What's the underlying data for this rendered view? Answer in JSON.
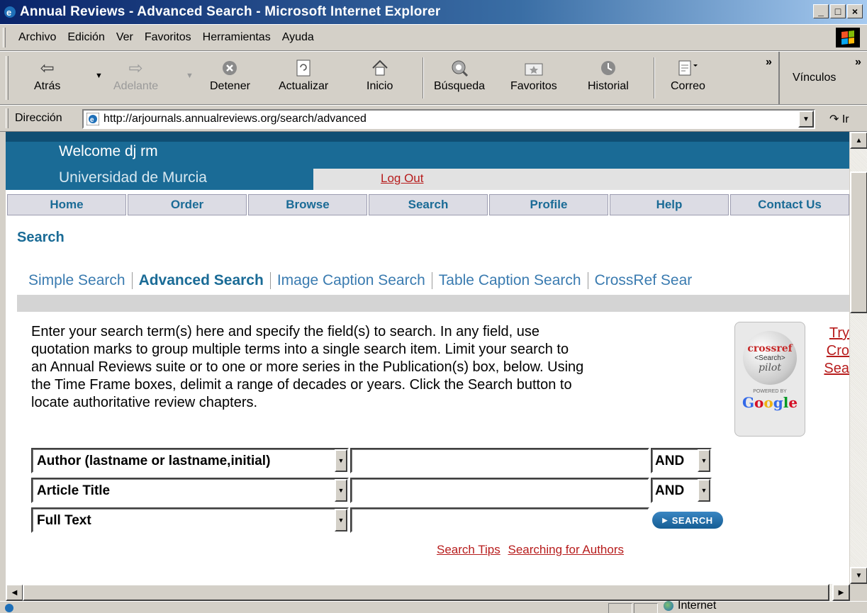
{
  "window": {
    "title": "Annual Reviews - Advanced Search - Microsoft Internet Explorer",
    "controls": [
      "_",
      "□",
      "×"
    ]
  },
  "menubar": {
    "items": [
      "Archivo",
      "Edición",
      "Ver",
      "Favoritos",
      "Herramientas",
      "Ayuda"
    ]
  },
  "toolbar": {
    "back": "Atrás",
    "forward": "Adelante",
    "stop": "Detener",
    "refresh": "Actualizar",
    "home": "Inicio",
    "search": "Búsqueda",
    "favorites": "Favoritos",
    "history": "Historial",
    "mail": "Correo",
    "links": "Vínculos"
  },
  "addressbar": {
    "label": "Dirección",
    "url": "http://arjournals.annualreviews.org/search/advanced",
    "go": "Ir"
  },
  "site": {
    "welcome": "Welcome dj rm",
    "institution": "Universidad de Murcia",
    "logout": "Log Out",
    "nav": [
      "Home",
      "Order",
      "Browse",
      "Search",
      "Profile",
      "Help",
      "Contact Us"
    ],
    "section_title": "Search",
    "tabs": [
      "Simple Search",
      "Advanced Search",
      "Image Caption Search",
      "Table Caption Search",
      "CrossRef Sear"
    ],
    "active_tab": "Advanced Search",
    "intro_lines": [
      "Enter your search term(s) here and specify the field(s) to search. In any field, use",
      "quotation marks to group multiple terms into a single search item. Limit your search to",
      "an Annual Reviews suite or to one or more series in the Publication(s) box, below. Using",
      "the Time Frame boxes, delimit a range of decades or years. Click the Search button to",
      "locate authoritative review chapters."
    ],
    "crossref_badge": {
      "line1": "crossref",
      "line2": "<Search>",
      "line3": "pilot",
      "powered": "POWERED BY",
      "google": "Google"
    },
    "try_link_lines": [
      "Try",
      "Cro",
      "Sea"
    ]
  },
  "search_form": {
    "rows": [
      {
        "field": "Author (lastname or lastname,initial)",
        "value": "",
        "operator": "AND"
      },
      {
        "field": "Article Title",
        "value": "",
        "operator": "AND"
      },
      {
        "field": "Full Text",
        "value": ""
      }
    ],
    "search_button": "SEARCH",
    "links": [
      "Search Tips",
      "Searching for Authors"
    ]
  },
  "status": {
    "zone": "Internet"
  },
  "colors": {
    "header_blue": "#1a6b96",
    "link_red": "#b71c1c",
    "titlebar": "#0a246a"
  }
}
